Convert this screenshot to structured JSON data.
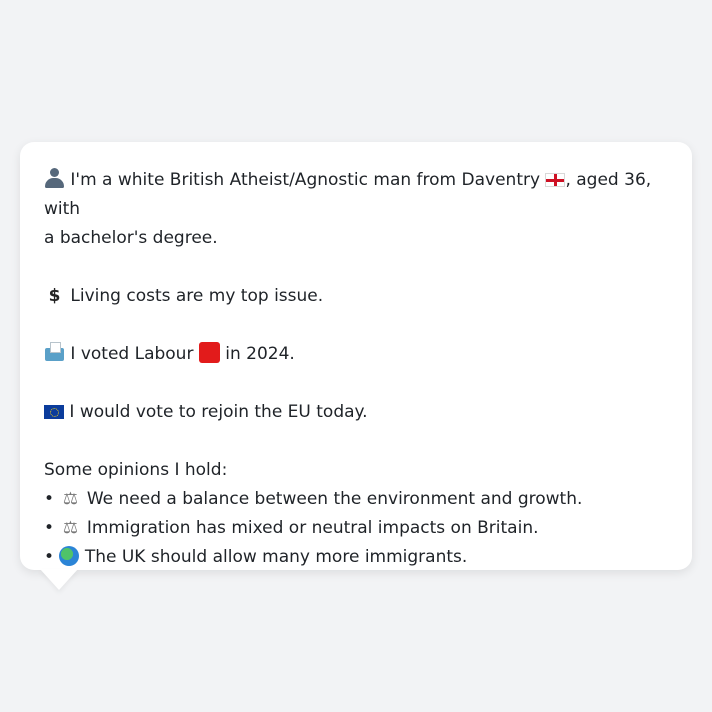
{
  "profile": {
    "intro_a": "I'm a white British Atheist/Agnostic man from Daventry",
    "intro_b": ", aged 36, with",
    "intro_c": "a bachelor's degree.",
    "issue": "Living costs are my top issue.",
    "vote_a": "I voted Labour",
    "vote_b": "in 2024.",
    "eu": "I would vote to rejoin the EU today.",
    "opinions_heading": "Some opinions I hold:",
    "bullet": "•",
    "opinions": [
      "We need a balance between the environment and growth.",
      "Immigration has mixed or neutral impacts on Britain.",
      "The UK should allow many more immigrants."
    ]
  },
  "icons": {
    "person": "person-icon",
    "england_flag": "england-flag-icon",
    "dollar": "dollar-sign-icon",
    "ballot": "ballot-box-icon",
    "labour_square": "red-square-icon",
    "eu_flag": "eu-flag-icon",
    "scale": "balance-scale-icon",
    "globe": "globe-icon"
  },
  "colors": {
    "background": "#f2f3f5",
    "bubble": "#ffffff",
    "text": "#1f2328",
    "labour_red": "#e21b1b"
  }
}
